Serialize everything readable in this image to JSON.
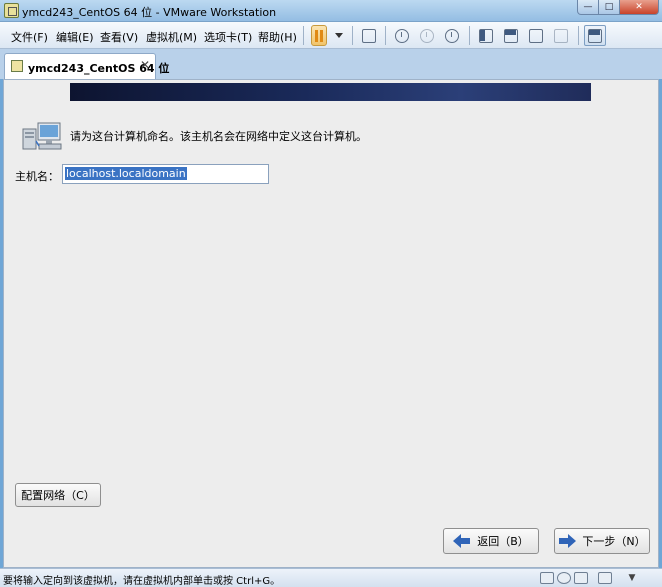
{
  "window": {
    "title": "ymcd243_CentOS 64 位 - VMware Workstation",
    "min_glyph": "—",
    "max_glyph": "□",
    "close_glyph": "✕"
  },
  "menu": {
    "file": "文件(F)",
    "edit": "编辑(E)",
    "view": "查看(V)",
    "vm": "虚拟机(M)",
    "tabs": "选项卡(T)",
    "help": "帮助(H)"
  },
  "tab": {
    "label": "ymcd243_CentOS 64 位",
    "close_glyph": "✕"
  },
  "installer": {
    "description": "请为这台计算机命名。该主机名会在网络中定义这台计算机。",
    "hostname_label": "主机名：",
    "hostname_value": "localhost.localdomain",
    "configure_network_button": "配置网络（C）",
    "back_button": "返回（B）",
    "next_button": "下一步（N）"
  },
  "statusbar": {
    "hint": "要将输入定向到该虚拟机，请在虚拟机内部单击或按 Ctrl+G。"
  },
  "colors": {
    "banner": "#1a2a5a",
    "selection": "#3a73c4",
    "arrow_blue": "#2f64b8"
  }
}
